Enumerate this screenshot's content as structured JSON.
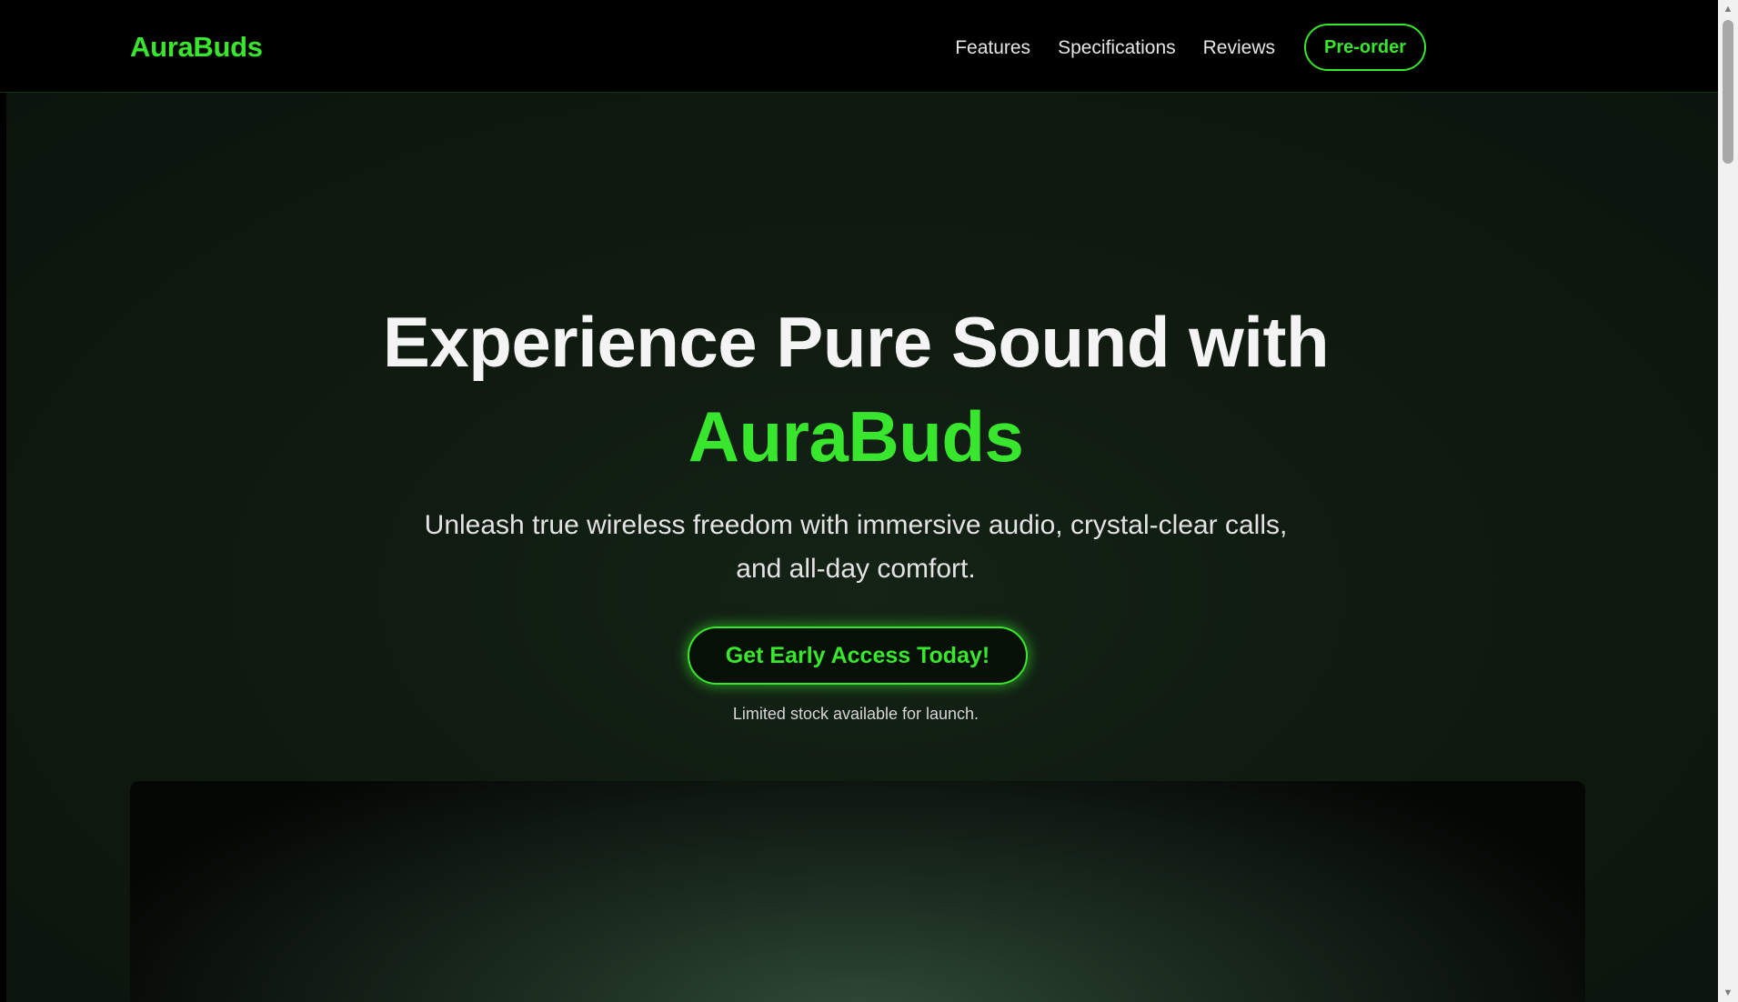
{
  "header": {
    "logo": "AuraBuds",
    "nav": [
      "Features",
      "Specifications",
      "Reviews"
    ],
    "cta": "Pre-order"
  },
  "hero": {
    "headline_line1": "Experience Pure Sound with",
    "headline_accent": "AuraBuds",
    "subheadline": "Unleash true wireless freedom with immersive audio, crystal-clear calls, and all-day comfort.",
    "cta": "Get Early Access Today!",
    "note": "Limited stock available for launch."
  },
  "scrollbar": {
    "up_icon": "▲",
    "down_icon": "▼"
  },
  "colors": {
    "accent": "#39e62e",
    "header_bg": "#000000",
    "hero_bg": "#0f1a10",
    "text": "#f4f4f4"
  },
  "icons": [
    "scroll-up-arrow-icon",
    "scroll-down-arrow-icon"
  ]
}
